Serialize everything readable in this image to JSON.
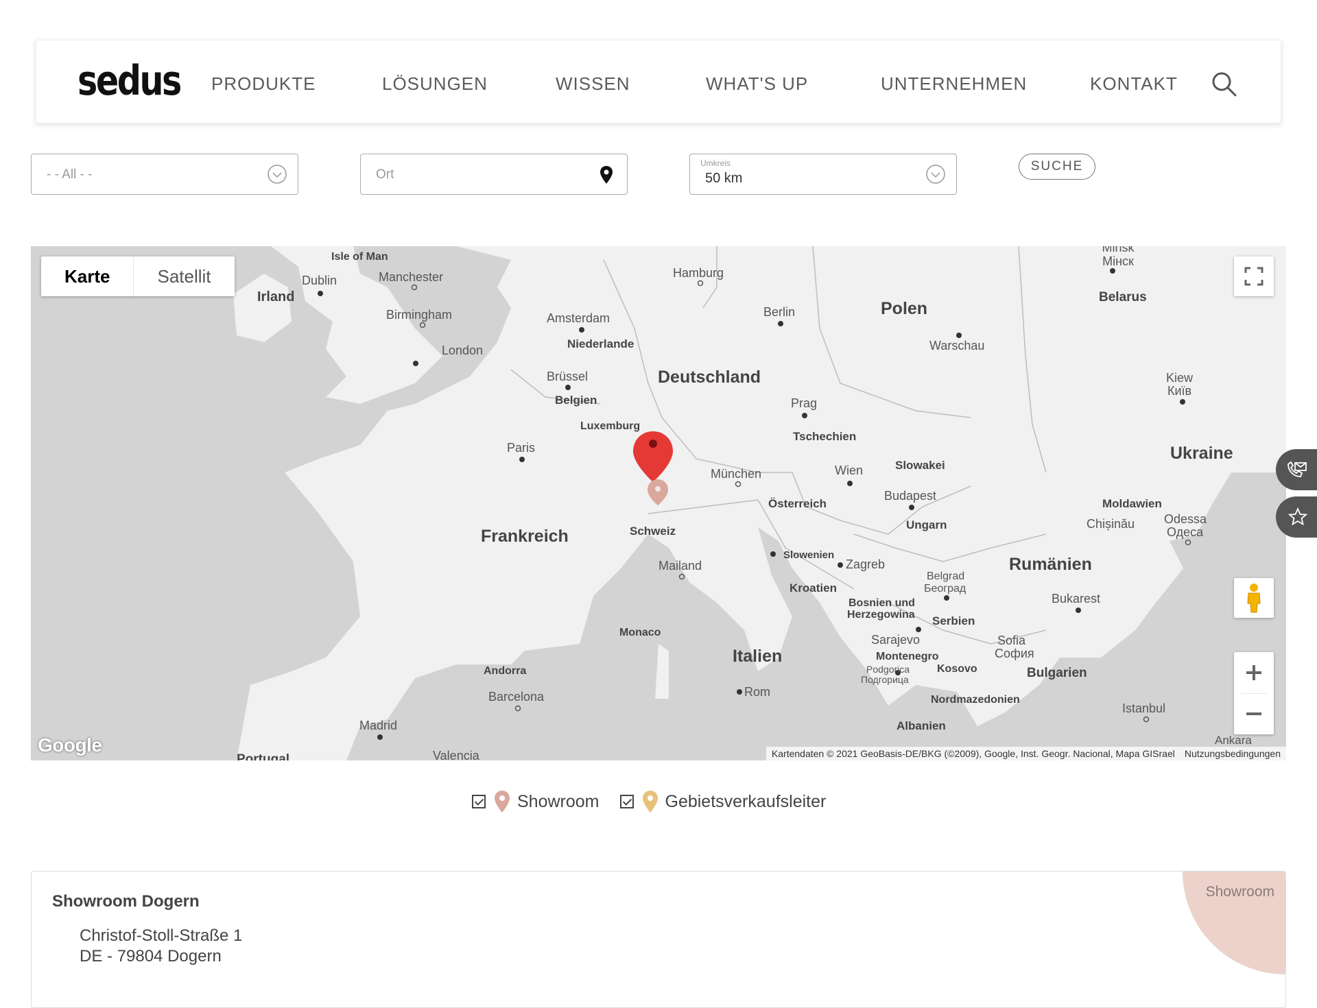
{
  "header": {
    "logo": "sedus",
    "nav": [
      "PRODUKTE",
      "LÖSUNGEN",
      "WISSEN",
      "WHAT'S UP",
      "UNTERNEHMEN",
      "KONTAKT"
    ]
  },
  "filters": {
    "category": "- - All - -",
    "location_placeholder": "Ort",
    "radius_label": "Umkreis",
    "radius_value": "50 km",
    "search_label": "SUCHE"
  },
  "map": {
    "type_buttons": [
      "Karte",
      "Satellit"
    ],
    "labels": {
      "isle_of_man": "Isle of Man",
      "dublin": "Dublin",
      "irland": "Irland",
      "manchester": "Manchester",
      "birmingham": "Birmingham",
      "london": "London",
      "hamburg": "Hamburg",
      "berlin": "Berlin",
      "amsterdam": "Amsterdam",
      "niederlande": "Niederlande",
      "bruessel": "Brüssel",
      "belgien": "Belgien",
      "luxemburg": "Luxemburg",
      "deutschland": "Deutschland",
      "paris": "Paris",
      "frankreich": "Frankreich",
      "prag": "Prag",
      "tschechien": "Tschechien",
      "muenchen": "München",
      "wien": "Wien",
      "oesterreich": "Österreich",
      "schweiz": "Schweiz",
      "mailand": "Mailand",
      "polen": "Polen",
      "warschau": "Warschau",
      "minsk": "Minsk Мінск",
      "belarus": "Belarus",
      "kiew": "Kiew",
      "kiew_cyr": "Київ",
      "ukraine": "Ukraine",
      "slowakei": "Slowakei",
      "budapest": "Budapest",
      "ungarn": "Ungarn",
      "moldawien": "Moldawien",
      "chisinau": "Chișinău",
      "odessa": "Odessa",
      "odessa_cyr": "Одеса",
      "slowenien": "Slowenien",
      "zagreb": "Zagreb",
      "kroatien": "Kroatien",
      "rumaenien": "Rumänien",
      "belgrad": "Belgrad",
      "belgrad_cyr": "Београд",
      "bukarest": "Bukarest",
      "bosnien": "Bosnien und",
      "herzegowina": "Herzegowina",
      "serbien": "Serbien",
      "sarajevo": "Sarajevo",
      "montenegro": "Montenegro",
      "podgorica": "Podgorica",
      "podgorica_cyr": "Подгорица",
      "kosovo": "Kosovo",
      "sofia": "Sofia",
      "sofia_cyr": "София",
      "bulgarien": "Bulgarien",
      "nordmazedonien": "Nordmazedonien",
      "albanien": "Albanien",
      "istanbul": "Istanbul",
      "ankara": "Ankara",
      "italien": "Italien",
      "rom": "Rom",
      "monaco": "Monaco",
      "andorra": "Andorra",
      "barcelona": "Barcelona",
      "madrid": "Madrid",
      "valencia": "Valencia",
      "portugal": "Portugal"
    },
    "attribution": "Kartendaten © 2021 GeoBasis-DE/BKG (©2009), Google, Inst. Geogr. Nacional, Mapa GISrael",
    "terms": "Nutzungsbedingungen",
    "google": "Google",
    "colors": {
      "land": "#f1f1f1",
      "water": "#d3d3d3",
      "pin_active": "#e53935",
      "pin_showroom": "#d9a89c",
      "pin_gvl": "#e8c27a"
    }
  },
  "legend": {
    "showroom": "Showroom",
    "gvl": "Gebietsverkaufsleiter"
  },
  "result": {
    "title": "Showroom Dogern",
    "street": "Christof-Stoll-Straße 1",
    "city": "DE - 79804 Dogern",
    "badge": "Showroom"
  }
}
